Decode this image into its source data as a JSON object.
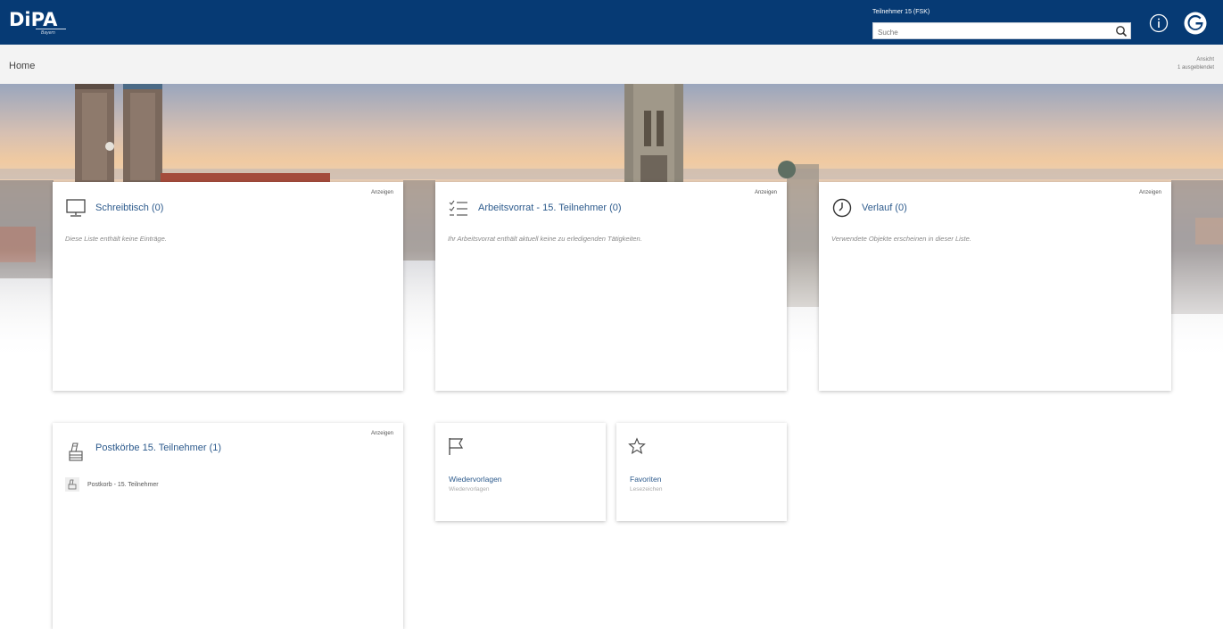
{
  "header": {
    "logo": "DiPA",
    "logo_sub": "Bayern",
    "user_label": "Teilnehmer 15 (FSK)",
    "search_placeholder": "Suche"
  },
  "breadcrumb": "Home",
  "view_info": {
    "line1": "Ansicht",
    "line2": "1 ausgeblendet"
  },
  "cards": {
    "desk": {
      "title": "Schreibtisch (0)",
      "show_label": "Anzeigen",
      "description": "Diese Liste enthält keine Einträge."
    },
    "worklist": {
      "title": "Arbeitsvorrat - 15. Teilnehmer (0)",
      "show_label": "Anzeigen",
      "description": "Ihr Arbeitsvorrat enthält aktuell keine zu erledigenden Tätigkeiten."
    },
    "history": {
      "title": "Verlauf (0)",
      "show_label": "Anzeigen",
      "description": "Verwendete Objekte erscheinen in dieser Liste."
    },
    "mailboxes": {
      "title": "Postkörbe 15. Teilnehmer (1)",
      "show_label": "Anzeigen",
      "items": [
        {
          "label": "Postkorb - 15. Teilnehmer"
        }
      ]
    }
  },
  "tiles": {
    "resubmissions": {
      "title": "Wiedervorlagen",
      "subtitle": "Wiedervorlagen"
    },
    "favorites": {
      "title": "Favoriten",
      "subtitle": "Lesezeichen"
    }
  },
  "colors": {
    "header_bg": "#063a74",
    "link_blue": "#2c5a8c",
    "crumb_bg": "#f3f3f3"
  },
  "icons": {
    "search": "search-icon",
    "info": "info-icon",
    "brand": "brand-logo-icon",
    "desk": "monitor-icon",
    "worklist": "checklist-icon",
    "history": "clock-icon",
    "mailbox": "mailbox-icon",
    "flag": "flag-icon",
    "star": "star-icon"
  }
}
